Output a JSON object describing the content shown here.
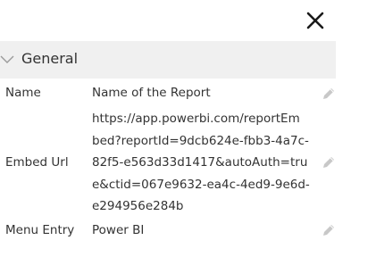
{
  "panel": {
    "close_icon": "close-icon",
    "section": {
      "title": "General",
      "expanded": true,
      "chevron_icon": "chevron-down-icon"
    },
    "properties": [
      {
        "label": "Name",
        "value_lines": [
          "Name of the Report"
        ],
        "edit_icon": "pencil-icon"
      },
      {
        "label": "Embed Url",
        "value_lines": [
          "https://app.powerbi.com/reportEm",
          "bed?reportId=9dcb624e-fbb3-4a7c-",
          "82f5-e563d33d1417&autoAuth=tru",
          "e&ctid=067e9632-ea4c-4ed9-9e6d-",
          "e294956e284b"
        ],
        "edit_icon": "pencil-icon"
      },
      {
        "label": "Menu Entry",
        "value_lines": [
          "Power BI"
        ],
        "edit_icon": "pencil-icon"
      }
    ]
  },
  "colors": {
    "text": "#333333",
    "section_bg": "#f0f0f0",
    "icon_muted": "#c8c8c8",
    "close": "#1a1a1a"
  }
}
